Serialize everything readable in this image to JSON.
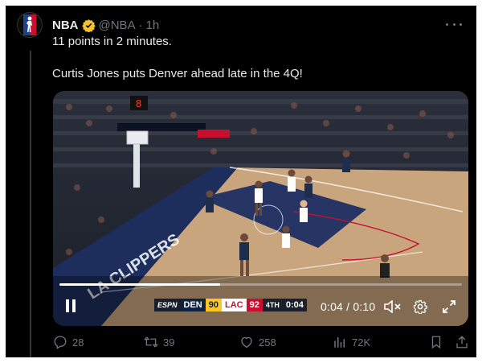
{
  "tweet": {
    "author_name": "NBA",
    "handle": "@NBA",
    "separator": "·",
    "time": "1h",
    "text_line1": "11 points in 2 minutes.",
    "text_line2": "Curtis Jones puts Denver ahead late in the 4Q!"
  },
  "video": {
    "progress": 0.4,
    "scorebug": {
      "network": "ESPN",
      "team1": "DEN",
      "score1": "90",
      "team2": "LAC",
      "score2": "92",
      "period": "4TH",
      "clock": "0:04"
    },
    "timecode": "0:04 / 0:10",
    "court_text": "LA CLIPPERS",
    "shot_clock": "8"
  },
  "actions": {
    "replies": "28",
    "reposts": "39",
    "likes": "258",
    "views": "72K"
  },
  "colors": {
    "background": "#000000",
    "text": "#e7e9ea",
    "muted": "#71767b",
    "verified": "#f4c430",
    "nuggets_navy": "#0e2240",
    "nuggets_gold": "#fec524",
    "clippers_red": "#c8102e"
  },
  "icons": {
    "avatar": "nba-logo",
    "verified": "verified-badge-icon",
    "more": "more-icon",
    "play": "pause-icon",
    "mute": "volume-muted-icon",
    "settings": "gear-icon",
    "fullscreen": "fullscreen-icon",
    "reply": "reply-icon",
    "repost": "repost-icon",
    "like": "heart-icon",
    "views": "views-icon",
    "bookmark": "bookmark-icon",
    "share": "share-icon"
  }
}
